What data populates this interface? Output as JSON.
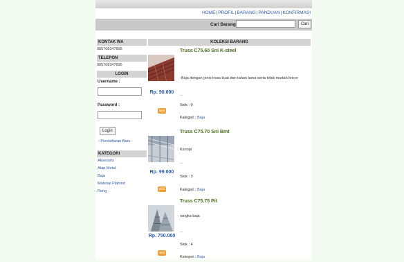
{
  "topnav": {
    "home": "HOME",
    "profil": "PROFIL",
    "barang": "BARANG",
    "panduan": "PANDUAN",
    "konfirmasi": "KONFIRMASI",
    "separator": "|"
  },
  "search": {
    "label": "Cari Barang :",
    "value": "",
    "placeholder": "",
    "button": "Cari"
  },
  "sidebar": {
    "kontak_wa_title": "KONTAK WA",
    "kontak_wa_value": "085708347895",
    "telepon_title": "TELEPON",
    "telepon_value": "085708347895",
    "login_title": "LOGIN",
    "username_label": "Username :",
    "password_label": "Password :",
    "login_button": "Login",
    "register_link": "› Pendaftaran Baru",
    "kategori_title": "KATEGORI",
    "categories": [
      "Aksesoris",
      "Atap Metal",
      "Baja",
      "Material Plafond",
      "Reng"
    ]
  },
  "main": {
    "header": "KOLEKSI BARANG",
    "products": [
      {
        "name": "Truss C75.60 Sni K-steel",
        "description": "-Baja dengan jenis truss kuat dan tahan lama serta tidak mudah bocor",
        "ellipsis": "...",
        "price": "Rp. 90.000",
        "stock": "Stok : 0",
        "category_label": "Kategori :",
        "category": "Baja",
        "buy": "Beli",
        "image_icon": "roof-truss-photo"
      },
      {
        "name": "Truss C75.70 Sni Bmt",
        "description": "Kanopi",
        "ellipsis": "...",
        "price": "Rp. 99.000",
        "stock": "Stok : 3",
        "category_label": "Kategori :",
        "category": "Baja",
        "buy": "Beli",
        "image_icon": "canopy-photo"
      },
      {
        "name": "Truss C75.75 Pit",
        "description": "rangka baja",
        "ellipsis": "...",
        "price": "Rp. 750.000",
        "stock": "Stok : 4",
        "category_label": "Kategori :",
        "category": "Baja",
        "buy": "Beli",
        "image_icon": "steel-frame-photo"
      }
    ]
  },
  "colors": {
    "link": "#2a56a8",
    "product_name": "#4a6b1a",
    "price": "#2d5ba8",
    "buy_button": "#f0a23a",
    "page_bg": "#f2fbef"
  }
}
